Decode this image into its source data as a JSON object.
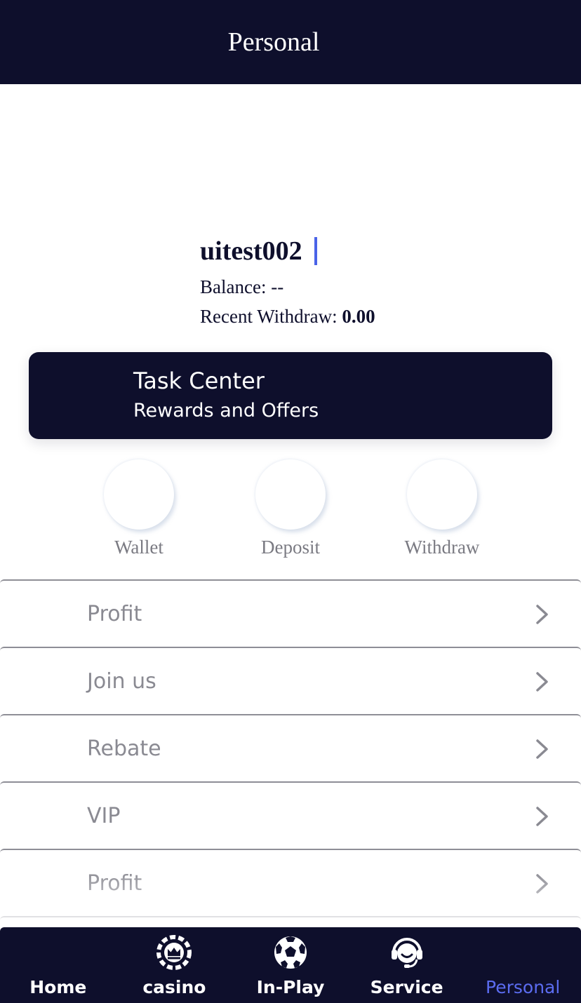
{
  "header": {
    "title": "Personal"
  },
  "profile": {
    "username": "uitest002",
    "balance_label": "Balance:",
    "balance_value": "--",
    "withdraw_label": "Recent Withdraw:",
    "withdraw_value": "0.00"
  },
  "task_card": {
    "title": "Task Center",
    "subtitle": "Rewards and Offers"
  },
  "actions": [
    {
      "label": "Wallet"
    },
    {
      "label": "Deposit"
    },
    {
      "label": "Withdraw"
    }
  ],
  "menu": [
    {
      "label": "Profit",
      "icon": "chevron-right-icon"
    },
    {
      "label": "Join us",
      "icon": "chevron-right-icon"
    },
    {
      "label": "Rebate",
      "icon": "chevron-right-icon"
    },
    {
      "label": "VIP",
      "icon": "chevron-right-icon"
    },
    {
      "label": "Profit",
      "icon": "chevron-right-icon"
    }
  ],
  "tabbar": [
    {
      "label": "Home",
      "icon": ""
    },
    {
      "label": "casino",
      "icon": "crown-chip-icon"
    },
    {
      "label": "In-Play",
      "icon": "soccer-ball-icon"
    },
    {
      "label": "Service",
      "icon": "headset-icon"
    },
    {
      "label": "Personal",
      "icon": "",
      "active": true
    }
  ],
  "colors": {
    "dark": "#0e0f2c",
    "accent": "#5b6cf0",
    "muted": "#8a8a92"
  }
}
